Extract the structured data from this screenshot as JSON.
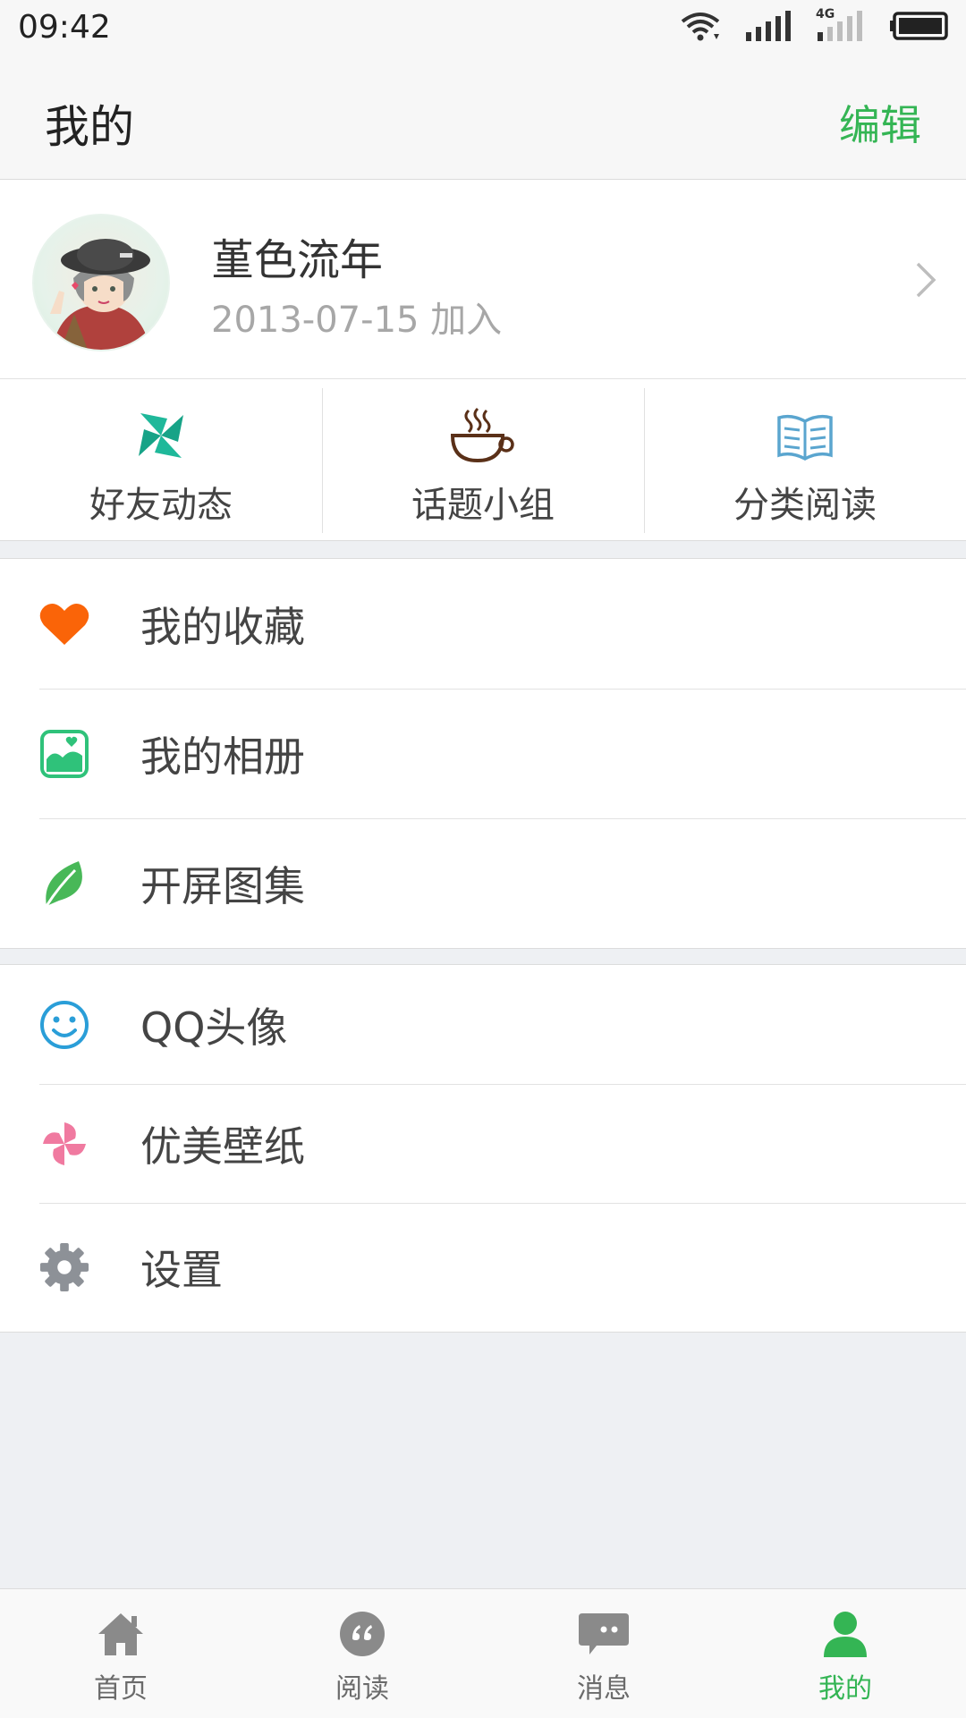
{
  "status_bar": {
    "time": "09:42",
    "network": "4G"
  },
  "header": {
    "title": "我的",
    "edit_label": "编辑"
  },
  "profile": {
    "name": "堇色流年",
    "joined": "2013-07-15 加入"
  },
  "shortcuts": [
    {
      "label": "好友动态",
      "icon": "pinwheel-icon"
    },
    {
      "label": "话题小组",
      "icon": "coffee-cup-icon"
    },
    {
      "label": "分类阅读",
      "icon": "open-book-icon"
    }
  ],
  "menu_group1": [
    {
      "label": "我的收藏",
      "icon": "heart-icon"
    },
    {
      "label": "我的相册",
      "icon": "photo-album-icon"
    },
    {
      "label": "开屏图集",
      "icon": "leaf-icon"
    }
  ],
  "menu_group2": [
    {
      "label": "QQ头像",
      "icon": "smiley-icon"
    },
    {
      "label": "优美壁纸",
      "icon": "pinwheel-icon"
    },
    {
      "label": "设置",
      "icon": "gear-icon"
    }
  ],
  "tabs": [
    {
      "label": "首页",
      "icon": "home-icon"
    },
    {
      "label": "阅读",
      "icon": "quote-icon"
    },
    {
      "label": "消息",
      "icon": "message-icon"
    },
    {
      "label": "我的",
      "icon": "person-icon"
    }
  ],
  "colors": {
    "accent": "#34b554",
    "heart": "#fa6408",
    "album": "#2fc27a",
    "leaf": "#48b858",
    "smiley": "#2a9ed8",
    "pinwheel": "#f07aa0",
    "gear": "#8d9197",
    "shortcut_teal": "#1fb89a",
    "shortcut_brown": "#5a3018",
    "shortcut_blue": "#5aa5cf"
  }
}
